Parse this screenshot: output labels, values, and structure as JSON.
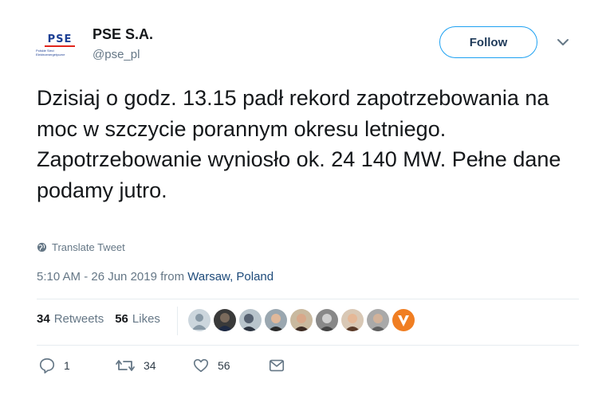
{
  "account": {
    "name": "PSE S.A.",
    "handle": "@pse_pl",
    "logo_text": "PSE",
    "logo_subtext": "Polskie Sieci Elektroenergetyczne"
  },
  "follow_button": {
    "label": "Follow"
  },
  "tweet": {
    "text": "Dzisiaj o godz. 13.15 padł rekord zapotrzebowania na moc w szczycie porannym okresu letniego. Zapotrzebowanie wyniosło ok. 24 140 MW. Pełne dane podamy jutro.",
    "translate_label": "Translate Tweet",
    "time": "5:10 AM - 26 Jun 2019 from ",
    "location": "Warsaw, Poland"
  },
  "stats": {
    "retweets_count": "34",
    "retweets_label": "Retweets",
    "likes_count": "56",
    "likes_label": "Likes"
  },
  "actions": {
    "reply_count": "1",
    "retweet_count": "34",
    "like_count": "56"
  },
  "icons": {
    "reply": "reply-icon",
    "retweet": "retweet-icon",
    "like": "heart-icon",
    "message": "message-icon",
    "globe": "globe-icon",
    "chevron": "chevron-down-icon"
  },
  "colors": {
    "accent": "#1da1f2",
    "text": "#14171a",
    "muted": "#657786",
    "brand_blue": "#1c3f94",
    "brand_red": "#e1251b"
  }
}
